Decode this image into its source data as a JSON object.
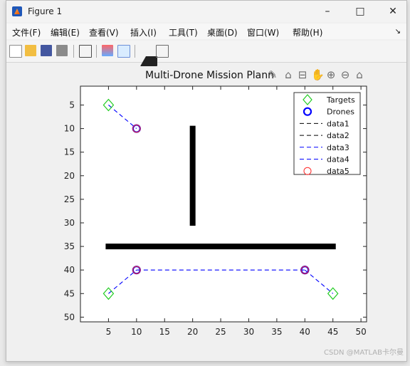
{
  "window": {
    "title": "Figure 1",
    "minimize": "–",
    "maximize": "□",
    "close": "✕"
  },
  "menu": [
    "文件(F)",
    "编辑(E)",
    "查看(V)",
    "插入(I)",
    "工具(T)",
    "桌面(D)",
    "窗口(W)",
    "帮助(H)"
  ],
  "axes_toolbar_icons": [
    "brush-icon",
    "data-tip-icon",
    "rotate-icon",
    "pan-icon",
    "zoom-in-icon",
    "zoom-out-icon",
    "home-icon"
  ],
  "footer": "CSDN @MATLAB卡尔曼",
  "chart_data": {
    "type": "scatter",
    "title": "Multi-Drone Mission Plann",
    "xlim": [
      0,
      51
    ],
    "ylim": [
      51,
      1
    ],
    "xticks": [
      5,
      10,
      15,
      20,
      25,
      30,
      35,
      40,
      45,
      50
    ],
    "yticks": [
      5,
      10,
      15,
      20,
      25,
      30,
      35,
      40,
      45,
      50
    ],
    "legend": {
      "location": "top-right",
      "entries": [
        "Targets",
        "Drones",
        "data1",
        "data2",
        "data3",
        "data4",
        "data5"
      ]
    },
    "targets": [
      [
        5,
        5
      ],
      [
        5,
        45
      ],
      [
        45,
        45
      ]
    ],
    "drones": [
      [
        10,
        10
      ],
      [
        10,
        40
      ],
      [
        40,
        40
      ],
      [
        40,
        40
      ]
    ],
    "paths": [
      {
        "name": "data1",
        "color": "#000000",
        "dash": "6 4",
        "points": [
          [
            20,
            10
          ],
          [
            20,
            30
          ]
        ]
      },
      {
        "name": "data2",
        "color": "#000000",
        "dash": "6 4",
        "points": [
          [
            5,
            35
          ],
          [
            45,
            35
          ]
        ]
      },
      {
        "name": "data3",
        "color": "#0000ff",
        "dash": "6 4",
        "points": [
          [
            5,
            5
          ],
          [
            10,
            10
          ]
        ]
      },
      {
        "name": "data4",
        "color": "#0000ff",
        "dash": "6 4",
        "points": [
          [
            5,
            45
          ],
          [
            10,
            40
          ],
          [
            40,
            40
          ],
          [
            45,
            45
          ]
        ]
      }
    ],
    "obstacles": [
      {
        "type": "vertical",
        "points": [
          [
            20,
            10
          ],
          [
            20,
            30
          ]
        ]
      },
      {
        "type": "horizontal",
        "points": [
          [
            5,
            35
          ],
          [
            45,
            35
          ]
        ]
      }
    ],
    "data5_points": [
      [
        10,
        10
      ],
      [
        10,
        40
      ],
      [
        40,
        40
      ]
    ],
    "colors": {
      "targets": "#22cc22",
      "drones": "#0000ff",
      "data5": "#ff2a2a",
      "axes": "#222222"
    }
  }
}
